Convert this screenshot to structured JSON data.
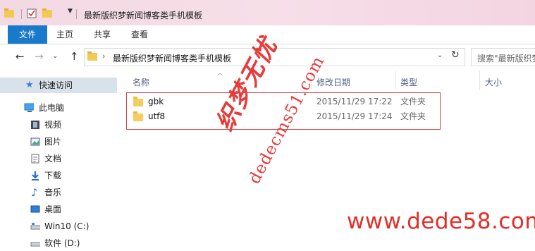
{
  "window": {
    "title": "最新版织梦新闻博客类手机模板"
  },
  "ribbon": {
    "tabs": [
      "文件",
      "主页",
      "共享",
      "查看"
    ]
  },
  "address": {
    "path": "最新版织梦新闻博客类手机模板",
    "search_placeholder": "搜索\"最新版织梦"
  },
  "sidebar": {
    "items": [
      {
        "label": "快速访问",
        "icon": "star-icon"
      },
      {
        "label": "此电脑",
        "icon": "computer-icon"
      },
      {
        "label": "视频",
        "icon": "video-icon"
      },
      {
        "label": "图片",
        "icon": "picture-icon"
      },
      {
        "label": "文档",
        "icon": "document-icon"
      },
      {
        "label": "下载",
        "icon": "download-icon"
      },
      {
        "label": "音乐",
        "icon": "music-icon"
      },
      {
        "label": "桌面",
        "icon": "desktop-icon"
      },
      {
        "label": "Win10 (C:)",
        "icon": "drive-icon"
      },
      {
        "label": "软件 (D:)",
        "icon": "drive-icon"
      }
    ]
  },
  "columns": {
    "name": "名称",
    "date": "修改日期",
    "type": "类型",
    "size": "大小"
  },
  "files": [
    {
      "name": "gbk",
      "date": "2015/11/29 17:22",
      "type": "文件夹"
    },
    {
      "name": "utf8",
      "date": "2015/11/29 17:24",
      "type": "文件夹"
    }
  ],
  "watermark": {
    "cn": "织梦无忧",
    "diag_url": "dedecms51.com",
    "url": "www.dede58.com"
  },
  "colors": {
    "accent": "#1979ca",
    "watermark": "#e52d27",
    "selection_box": "#d94040"
  }
}
